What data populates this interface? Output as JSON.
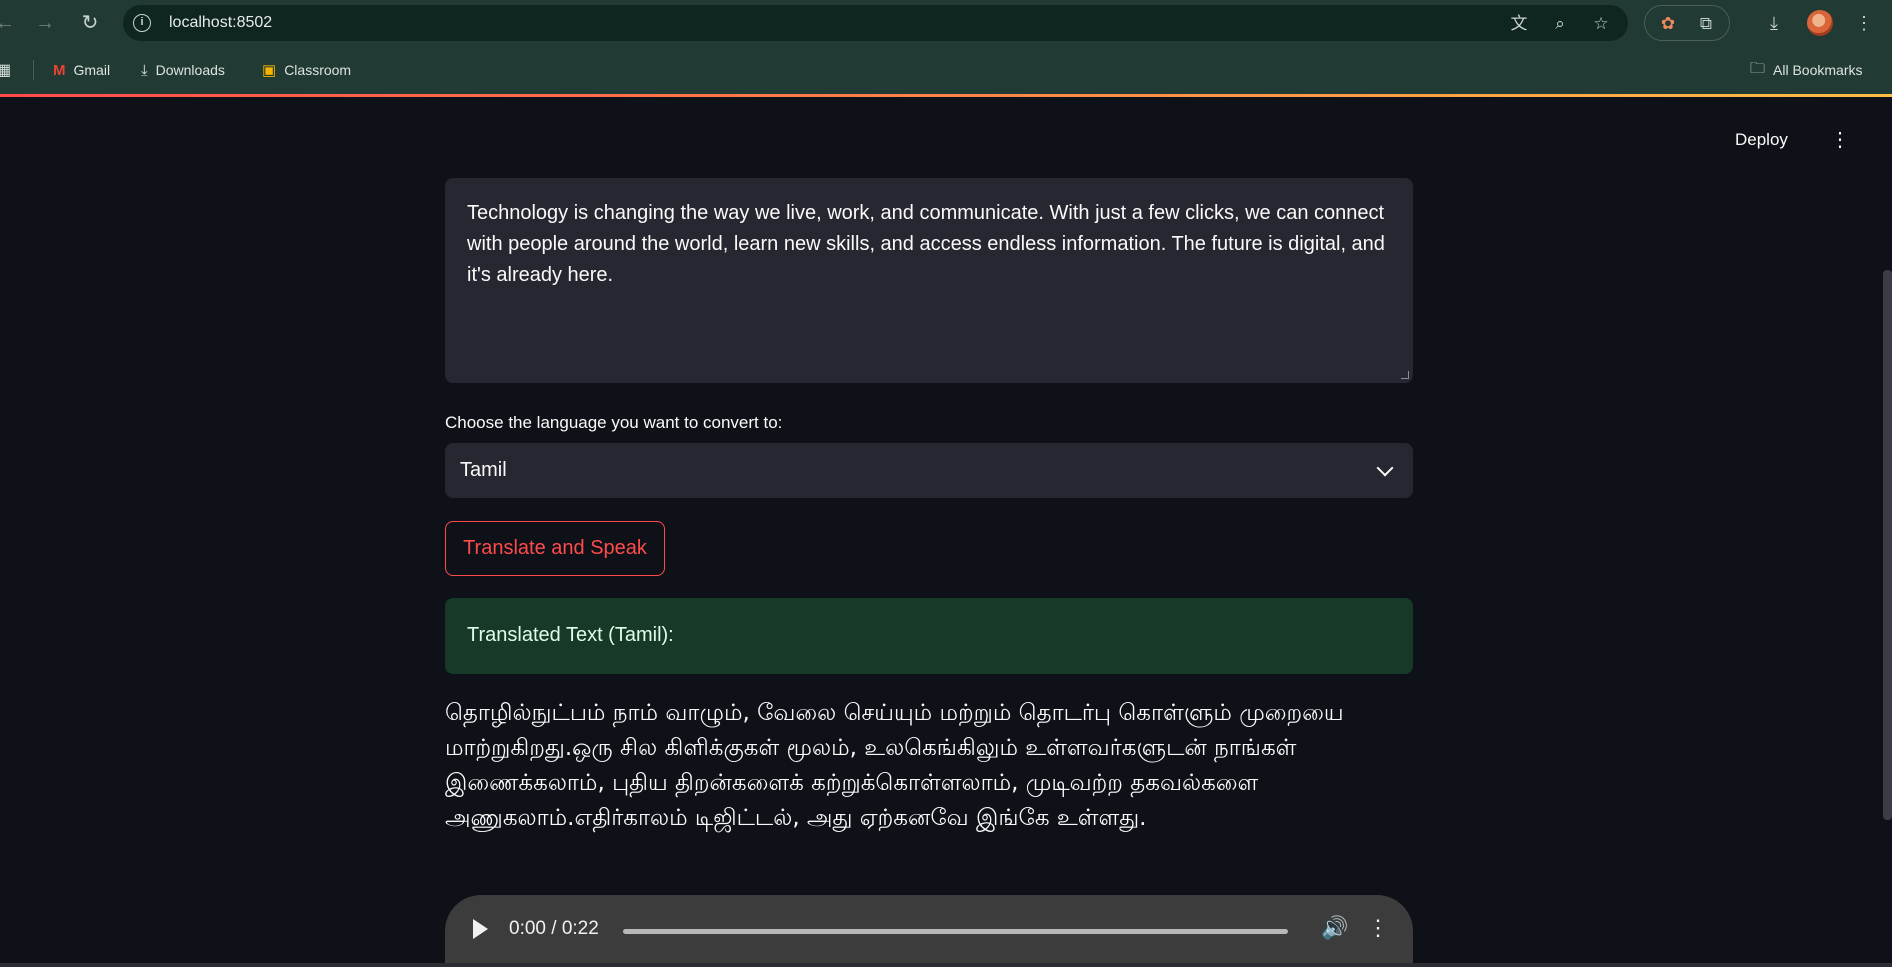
{
  "browser": {
    "url": "localhost:8502",
    "bookmarks": [
      {
        "label": "Gmail",
        "icon": "gmail-icon"
      },
      {
        "label": "Downloads",
        "icon": "download-icon"
      },
      {
        "label": "Classroom",
        "icon": "classroom-icon"
      }
    ],
    "all_bookmarks_label": "All Bookmarks"
  },
  "app": {
    "deploy_label": "Deploy",
    "input_text": "Technology is changing the way we live, work, and communicate. With just a few clicks, we can connect with people around the world, learn new skills, and access endless information. The future is digital, and it's already here.",
    "select_label": "Choose the language you want to convert to:",
    "selected_language": "Tamil",
    "button_label": "Translate and Speak",
    "success_text": "Translated Text (Tamil):",
    "translated_text": "தொழில்நுட்பம் நாம் வாழும், வேலை செய்யும் மற்றும் தொடர்பு கொள்ளும் முறையை மாற்றுகிறது.ஒரு சில கிளிக்குகள் மூலம், உலகெங்கிலும் உள்ளவர்களுடன் நாங்கள் இணைக்கலாம், புதிய திறன்களைக் கற்றுக்கொள்ளலாம், முடிவற்ற தகவல்களை அணுகலாம்.எதிர்காலம் டிஜிட்டல், அது ஏற்கனவே இங்கே உள்ளது.",
    "audio": {
      "time_display": "0:00 / 0:22",
      "progress": 0
    }
  },
  "colors": {
    "accent": "#ff4b4b",
    "background": "#0e1117",
    "success_bg": "#173928"
  }
}
